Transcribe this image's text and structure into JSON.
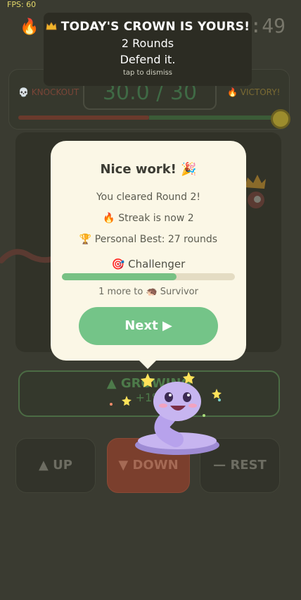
{
  "hud": {
    "fps": "FPS: 60",
    "timer": "4:49",
    "score": "30.0 / 30",
    "knockout_label": "KNOCKOUT",
    "victory_label": "VICTORY!",
    "progress_fraction": 0.5
  },
  "toast": {
    "line1": "TODAY'S CROWN IS YOURS!",
    "line2": "2 Rounds",
    "line3": "Defend it.",
    "hint": "tap to dismiss"
  },
  "modal": {
    "title": "Nice work! 🎉",
    "cleared": "You cleared Round 2!",
    "streak": "Streak is now 2",
    "best": "Personal Best: 27 rounds",
    "rank": "Challenger",
    "rank_progress": 0.66,
    "next_rank_text": "1 more to",
    "next_rank": "Survivor",
    "next_button": "Next"
  },
  "status": {
    "growing": "GROWING",
    "growing_sub": "+1%"
  },
  "controls": {
    "up": "UP",
    "down": "DOWN",
    "rest": "REST"
  },
  "colors": {
    "accent_green": "#74c488",
    "danger_red": "#7b3f2d",
    "modal_bg": "#fbf7e6"
  }
}
